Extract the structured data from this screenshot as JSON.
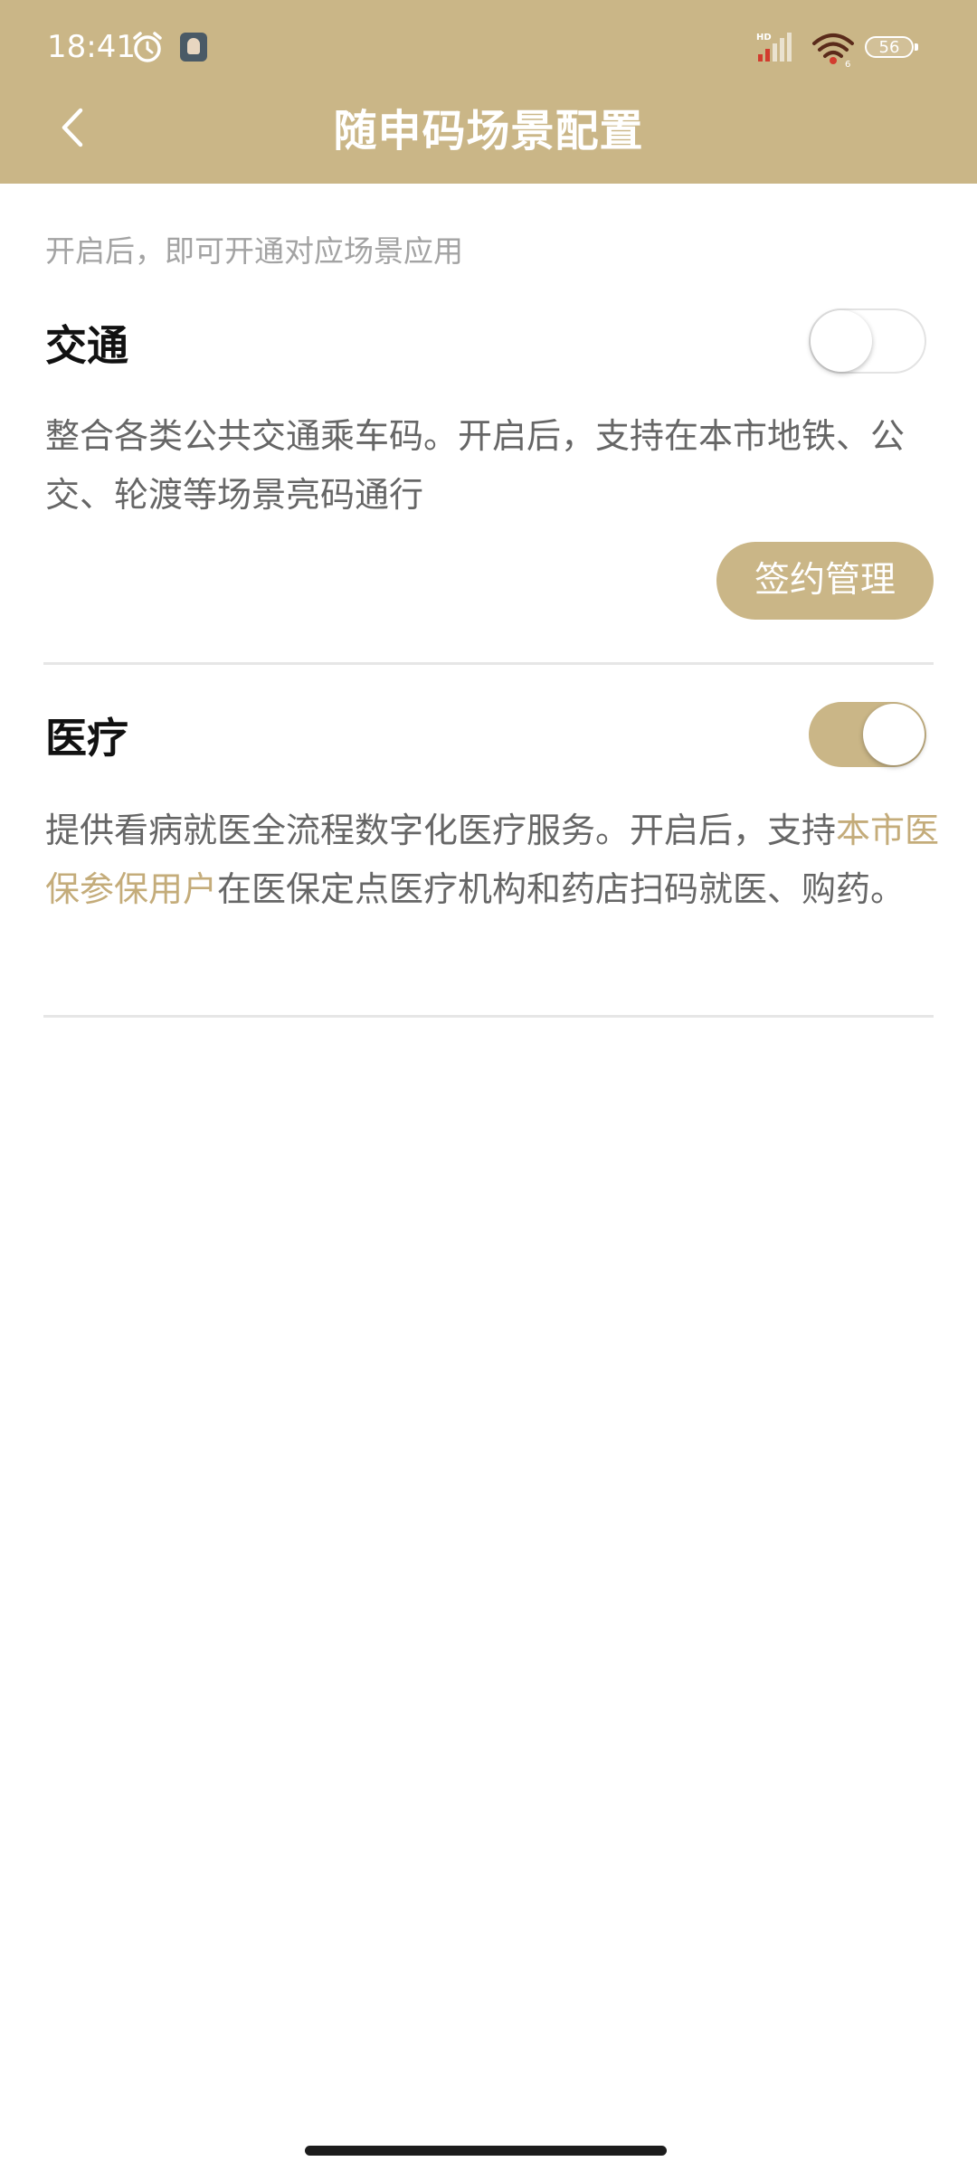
{
  "status_bar": {
    "time": "18:41",
    "battery": "56",
    "icons": [
      "alarm-icon",
      "app-notification-icon",
      "hd-signal-icon",
      "wifi-icon",
      "battery-icon"
    ]
  },
  "header": {
    "title": "随申码场景配置",
    "back_icon": "chevron-left-icon",
    "background_color": "#cab687"
  },
  "hint": "开启后，即可开通对应场景应用",
  "sections": [
    {
      "title": "交通",
      "enabled": false,
      "description": "整合各类公共交通乘车码。开启后，支持在本市地铁、公交、轮渡等场景亮码通行",
      "button_label": "签约管理"
    },
    {
      "title": "医疗",
      "enabled": true,
      "description_before": "提供看病就医全流程数字化医疗服务。开启后，支持",
      "description_link": "本市医保参保用户",
      "description_after": "在医保定点医疗机构和药店扫码就医、购药。"
    }
  ],
  "colors": {
    "accent": "#cab687",
    "link": "#c4ac7a",
    "text_secondary": "#666666",
    "hint": "#a3a3a3"
  }
}
